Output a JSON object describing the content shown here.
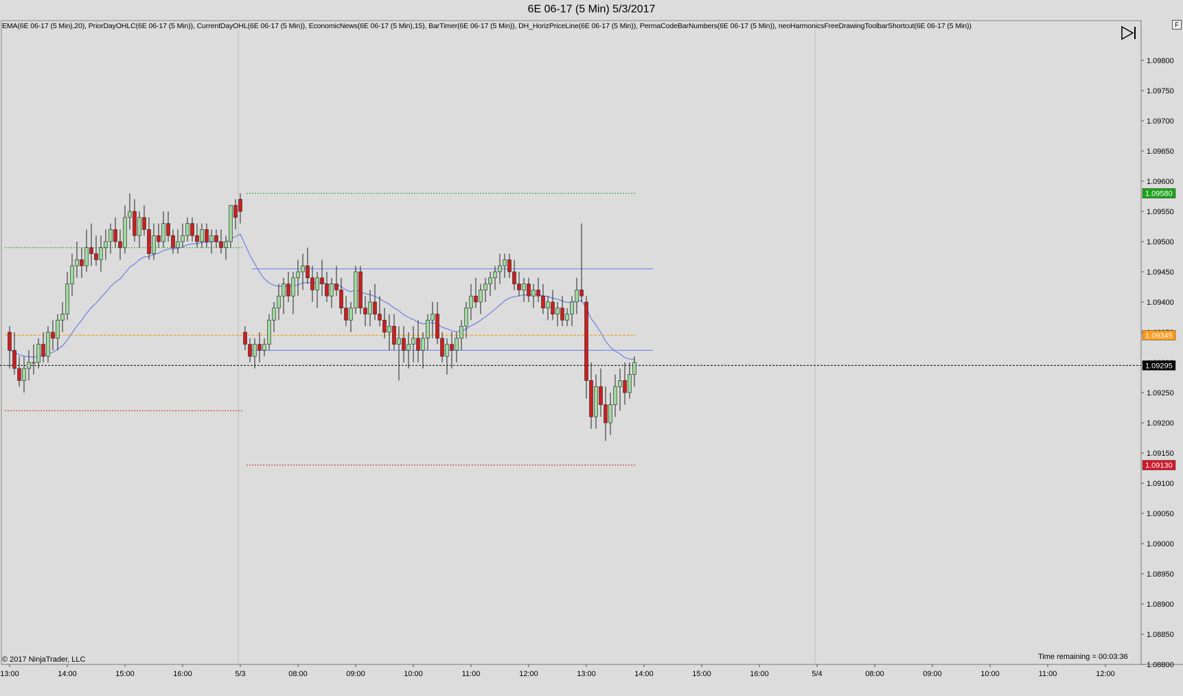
{
  "window": {
    "title": "6E 06-17 (5 Min)  5/3/2017",
    "f_button": "F"
  },
  "indicators_text": "EMA(6E 06-17 (5 Min),20), PriorDayOHLC(6E 06-17 (5 Min)), CurrentDayOHL(6E 06-17 (5 Min)), EconomicNews(6E 06-17 (5 Min),15), BarTimer(6E 06-17 (5 Min)), DH_HorizPriceLine(6E 06-17 (5 Min)), PermaCodeBarNumbers(6E 06-17 (5 Min)), neoHarmonicsFreeDrawingToolbarShortcut(6E 06-17 (5 Min))",
  "copyright": "© 2017 NinjaTrader, LLC",
  "time_remaining": "Time remaining = 00:03:36",
  "icons": {
    "toolbar": "play-to-end-icon"
  },
  "colors": {
    "background": "#dcdcdc",
    "up_candle": "#9fd89f",
    "down_candle": "#cc1f1f",
    "wick": "#222222",
    "ema": "#6f7fe0",
    "channel": "#7d8fe8",
    "prior_close": "#ff9900",
    "current_high": "#2e9b2e",
    "current_low": "#d0202a",
    "last_price": "#000000",
    "badge_high": "#1aa31a",
    "badge_orange": "#ff9a1a",
    "badge_low": "#d0182a",
    "badge_last": "#000000"
  },
  "chart_data": {
    "type": "candlestick",
    "instrument": "6E 06-17",
    "interval": "5 Min",
    "ylim": [
      1.088,
      1.0985
    ],
    "y_ticks": [
      "1.09800",
      "1.09750",
      "1.09700",
      "1.09650",
      "1.09600",
      "1.09550",
      "1.09500",
      "1.09450",
      "1.09400",
      "1.09350",
      "1.09300",
      "1.09250",
      "1.09200",
      "1.09150",
      "1.09100",
      "1.09050",
      "1.09000",
      "1.08950",
      "1.08900",
      "1.08850",
      "1.08800"
    ],
    "x_ticks": [
      {
        "label": "13:00",
        "bar": 0
      },
      {
        "label": "14:00",
        "bar": 12
      },
      {
        "label": "15:00",
        "bar": 24
      },
      {
        "label": "16:00",
        "bar": 36
      },
      {
        "label": "5/3",
        "bar": 48
      },
      {
        "label": "08:00",
        "bar": 60
      },
      {
        "label": "09:00",
        "bar": 72
      },
      {
        "label": "10:00",
        "bar": 84
      },
      {
        "label": "11:00",
        "bar": 96
      },
      {
        "label": "12:00",
        "bar": 108
      },
      {
        "label": "13:00",
        "bar": 120
      },
      {
        "label": "14:00",
        "bar": 132
      },
      {
        "label": "15:00",
        "bar": 144
      },
      {
        "label": "16:00",
        "bar": 156
      },
      {
        "label": "5/4",
        "bar": 168
      },
      {
        "label": "08:00",
        "bar": 180
      },
      {
        "label": "09:00",
        "bar": 192
      },
      {
        "label": "10:00",
        "bar": 204
      },
      {
        "label": "11:00",
        "bar": 216
      },
      {
        "label": "12:00",
        "bar": 228
      }
    ],
    "session_breaks": [
      48,
      168
    ],
    "bars_ohlc": [
      [
        1.0935,
        1.0936,
        1.0929,
        1.0932
      ],
      [
        1.0932,
        1.0935,
        1.0928,
        1.0929
      ],
      [
        1.0929,
        1.0931,
        1.0926,
        1.0927
      ],
      [
        1.0927,
        1.0931,
        1.0925,
        1.0929
      ],
      [
        1.0929,
        1.0932,
        1.0927,
        1.093
      ],
      [
        1.093,
        1.0933,
        1.0928,
        1.093
      ],
      [
        1.093,
        1.0934,
        1.0929,
        1.0933
      ],
      [
        1.0933,
        1.0935,
        1.093,
        1.0931
      ],
      [
        1.0931,
        1.0936,
        1.093,
        1.0935
      ],
      [
        1.0935,
        1.0937,
        1.0932,
        1.0934
      ],
      [
        1.0934,
        1.0938,
        1.0932,
        1.0937
      ],
      [
        1.0937,
        1.094,
        1.0935,
        1.0938
      ],
      [
        1.0938,
        1.0945,
        1.0937,
        1.0943
      ],
      [
        1.0943,
        1.0948,
        1.0941,
        1.0946
      ],
      [
        1.0946,
        1.095,
        1.0944,
        1.0947
      ],
      [
        1.0947,
        1.0949,
        1.0944,
        1.0946
      ],
      [
        1.0946,
        1.0952,
        1.0945,
        1.0949
      ],
      [
        1.0949,
        1.0953,
        1.0946,
        1.0948
      ],
      [
        1.0948,
        1.0951,
        1.0946,
        1.0947
      ],
      [
        1.0947,
        1.0951,
        1.0945,
        1.0949
      ],
      [
        1.0949,
        1.0952,
        1.0947,
        1.095
      ],
      [
        1.095,
        1.0953,
        1.0948,
        1.0952
      ],
      [
        1.0952,
        1.0954,
        1.0949,
        1.095
      ],
      [
        1.095,
        1.0952,
        1.0947,
        1.0949
      ],
      [
        1.0949,
        1.0956,
        1.0948,
        1.0954
      ],
      [
        1.0954,
        1.0958,
        1.0952,
        1.0955
      ],
      [
        1.0955,
        1.0957,
        1.095,
        1.0951
      ],
      [
        1.0951,
        1.0955,
        1.0949,
        1.0954
      ],
      [
        1.0954,
        1.0956,
        1.0951,
        1.0952
      ],
      [
        1.0952,
        1.0954,
        1.0947,
        1.0948
      ],
      [
        1.0948,
        1.0953,
        1.0947,
        1.0951
      ],
      [
        1.0951,
        1.0953,
        1.0949,
        1.095
      ],
      [
        1.095,
        1.0955,
        1.0949,
        1.0953
      ],
      [
        1.0953,
        1.0955,
        1.095,
        1.0951
      ],
      [
        1.0951,
        1.0952,
        1.0948,
        1.0949
      ],
      [
        1.0949,
        1.0952,
        1.0948,
        1.095
      ],
      [
        1.095,
        1.0953,
        1.0949,
        1.0951
      ],
      [
        1.0951,
        1.0954,
        1.095,
        1.0953
      ],
      [
        1.0953,
        1.0954,
        1.095,
        1.0951
      ],
      [
        1.0951,
        1.0953,
        1.0949,
        1.095
      ],
      [
        1.095,
        1.0953,
        1.0949,
        1.0952
      ],
      [
        1.0952,
        1.0953,
        1.0949,
        1.095
      ],
      [
        1.095,
        1.0952,
        1.0948,
        1.0951
      ],
      [
        1.0951,
        1.0952,
        1.0949,
        1.095
      ],
      [
        1.095,
        1.0952,
        1.0948,
        1.0949
      ],
      [
        1.0949,
        1.0951,
        1.0947,
        1.095
      ],
      [
        1.095,
        1.0956,
        1.0949,
        1.0956
      ],
      [
        1.0956,
        1.0957,
        1.0952,
        1.0954
      ],
      [
        1.0957,
        1.0958,
        1.0953,
        1.0955
      ],
      [
        1.0935,
        1.0936,
        1.0932,
        1.0933
      ],
      [
        1.0933,
        1.0934,
        1.093,
        1.0931
      ],
      [
        1.0931,
        1.0934,
        1.0929,
        1.0933
      ],
      [
        1.0933,
        1.0935,
        1.093,
        1.0932
      ],
      [
        1.0932,
        1.0934,
        1.0931,
        1.0933
      ],
      [
        1.0933,
        1.0938,
        1.0932,
        1.0937
      ],
      [
        1.0937,
        1.094,
        1.0935,
        1.0939
      ],
      [
        1.0939,
        1.0943,
        1.0937,
        1.0941
      ],
      [
        1.0941,
        1.0944,
        1.0938,
        1.0943
      ],
      [
        1.0943,
        1.0945,
        1.094,
        1.0941
      ],
      [
        1.0941,
        1.0945,
        1.0938,
        1.0944
      ],
      [
        1.0944,
        1.0947,
        1.0941,
        1.0945
      ],
      [
        1.0945,
        1.0948,
        1.0942,
        1.0946
      ],
      [
        1.0946,
        1.0949,
        1.0943,
        1.0944
      ],
      [
        1.0944,
        1.0946,
        1.094,
        1.0942
      ],
      [
        1.0942,
        1.0945,
        1.0939,
        1.0944
      ],
      [
        1.0944,
        1.0947,
        1.0941,
        1.0943
      ],
      [
        1.0943,
        1.0945,
        1.094,
        1.0941
      ],
      [
        1.0941,
        1.0944,
        1.0939,
        1.0943
      ],
      [
        1.0943,
        1.0946,
        1.0941,
        1.0942
      ],
      [
        1.0942,
        1.0944,
        1.0938,
        1.0939
      ],
      [
        1.0939,
        1.0941,
        1.0936,
        1.0937
      ],
      [
        1.0937,
        1.094,
        1.0935,
        1.0939
      ],
      [
        1.0939,
        1.0946,
        1.0938,
        1.0945
      ],
      [
        1.0945,
        1.0946,
        1.0938,
        1.0939
      ],
      [
        1.0939,
        1.0941,
        1.0936,
        1.0938
      ],
      [
        1.0938,
        1.0942,
        1.0936,
        1.094
      ],
      [
        1.094,
        1.0943,
        1.0937,
        1.0938
      ],
      [
        1.0938,
        1.0941,
        1.0936,
        1.0937
      ],
      [
        1.0937,
        1.0939,
        1.0934,
        1.0935
      ],
      [
        1.0935,
        1.0938,
        1.0932,
        1.0936
      ],
      [
        1.0936,
        1.0938,
        1.0932,
        1.0933
      ],
      [
        1.0933,
        1.0936,
        1.0927,
        1.0934
      ],
      [
        1.0934,
        1.0936,
        1.093,
        1.0932
      ],
      [
        1.0932,
        1.0935,
        1.0929,
        1.0933
      ],
      [
        1.0933,
        1.0936,
        1.093,
        1.0934
      ],
      [
        1.0934,
        1.0937,
        1.093,
        1.0932
      ],
      [
        1.0932,
        1.0935,
        1.0929,
        1.0934
      ],
      [
        1.0934,
        1.0938,
        1.0932,
        1.0937
      ],
      [
        1.0937,
        1.094,
        1.0934,
        1.0938
      ],
      [
        1.0938,
        1.094,
        1.0933,
        1.0934
      ],
      [
        1.0934,
        1.0935,
        1.093,
        1.0931
      ],
      [
        1.0931,
        1.0934,
        1.0928,
        1.0933
      ],
      [
        1.0933,
        1.0935,
        1.0929,
        1.0932
      ],
      [
        1.0932,
        1.0935,
        1.093,
        1.0934
      ],
      [
        1.0934,
        1.0937,
        1.0932,
        1.0936
      ],
      [
        1.0936,
        1.094,
        1.0934,
        1.0939
      ],
      [
        1.0939,
        1.0943,
        1.0937,
        1.0941
      ],
      [
        1.0941,
        1.0944,
        1.0939,
        1.094
      ],
      [
        1.094,
        1.0943,
        1.0938,
        1.0942
      ],
      [
        1.0942,
        1.0944,
        1.094,
        1.0943
      ],
      [
        1.0943,
        1.0945,
        1.0941,
        1.0944
      ],
      [
        1.0944,
        1.0946,
        1.0942,
        1.0945
      ],
      [
        1.0945,
        1.0948,
        1.0943,
        1.0946
      ],
      [
        1.0946,
        1.0948,
        1.0944,
        1.0947
      ],
      [
        1.0947,
        1.0948,
        1.0944,
        1.0945
      ],
      [
        1.0945,
        1.0947,
        1.0942,
        1.0943
      ],
      [
        1.0943,
        1.0945,
        1.0941,
        1.0942
      ],
      [
        1.0942,
        1.0944,
        1.094,
        1.0943
      ],
      [
        1.0943,
        1.0944,
        1.094,
        1.0941
      ],
      [
        1.0941,
        1.0943,
        1.0939,
        1.0942
      ],
      [
        1.0942,
        1.0944,
        1.094,
        1.0941
      ],
      [
        1.0941,
        1.0943,
        1.0938,
        1.0939
      ],
      [
        1.0939,
        1.0941,
        1.0937,
        1.094
      ],
      [
        1.094,
        1.0942,
        1.0937,
        1.0938
      ],
      [
        1.0938,
        1.094,
        1.0936,
        1.0939
      ],
      [
        1.0939,
        1.0941,
        1.0936,
        1.0937
      ],
      [
        1.0937,
        1.0939,
        1.0936,
        1.0938
      ],
      [
        1.0938,
        1.0941,
        1.0936,
        1.094
      ],
      [
        1.094,
        1.0944,
        1.0938,
        1.0942
      ],
      [
        1.0942,
        1.0953,
        1.094,
        1.0941
      ],
      [
        1.094,
        1.0941,
        1.0924,
        1.0927
      ],
      [
        1.0927,
        1.093,
        1.0919,
        1.0921
      ],
      [
        1.0921,
        1.0928,
        1.0919,
        1.0926
      ],
      [
        1.0926,
        1.0929,
        1.0921,
        1.0923
      ],
      [
        1.0923,
        1.0926,
        1.0917,
        1.092
      ],
      [
        1.092,
        1.0925,
        1.0918,
        1.0923
      ],
      [
        1.0923,
        1.0928,
        1.0921,
        1.0926
      ],
      [
        1.0926,
        1.0929,
        1.0922,
        1.0927
      ],
      [
        1.0927,
        1.093,
        1.0923,
        1.0925
      ],
      [
        1.0925,
        1.093,
        1.0924,
        1.0928
      ],
      [
        1.0928,
        1.0931,
        1.0926,
        1.093
      ]
    ],
    "ema_period": 20,
    "lines": {
      "prior_close": 1.09345,
      "prior_high": 1.0949,
      "prior_low": 1.0922,
      "current_high": 1.0958,
      "current_low": 1.0913,
      "channel_upper": 1.09455,
      "channel_lower": 1.0932,
      "last_price": 1.09295
    },
    "price_badges": [
      {
        "label": "1.09580",
        "value": 1.0958,
        "color": "#1aa31a"
      },
      {
        "label": "1.09345",
        "value": 1.09345,
        "color": "#ff9a1a"
      },
      {
        "label": "1.09295",
        "value": 1.09295,
        "color": "#000000"
      },
      {
        "label": "1.09130",
        "value": 1.0913,
        "color": "#d0182a"
      }
    ]
  }
}
